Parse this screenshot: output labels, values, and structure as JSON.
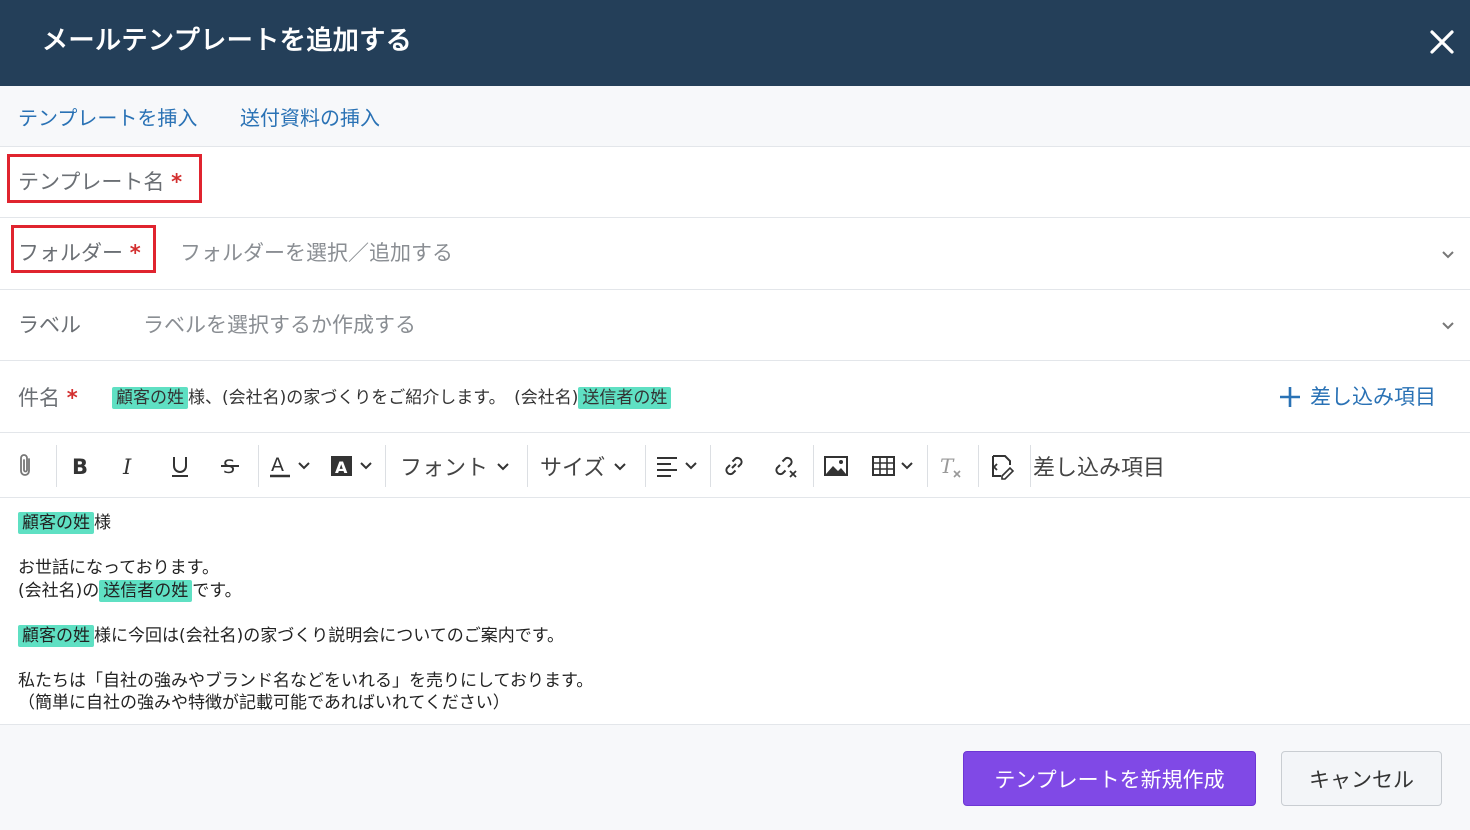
{
  "header": {
    "title": "メールテンプレートを追加する"
  },
  "topbar": {
    "insert_template": "テンプレートを挿入",
    "insert_attachment": "送付資料の挿入"
  },
  "fields": {
    "template_name": {
      "label": "テンプレート名",
      "required_mark": "*"
    },
    "folder": {
      "label": "フォルダー",
      "required_mark": "*",
      "placeholder": "フォルダーを選択／追加する"
    },
    "label": {
      "label": "ラベル",
      "placeholder": "ラベルを選択するか作成する"
    },
    "subject": {
      "label": "件名",
      "required_mark": "*",
      "chip1": "顧客の姓",
      "text1": "様、(会社名)の家づくりをご紹介します。　(会社名)",
      "chip2": "送信者の姓",
      "merge_label": "差し込み項目"
    }
  },
  "toolbar": {
    "font_label": "フォント",
    "size_label": "サイズ",
    "merge_label": "差し込み項目"
  },
  "editor": {
    "chip_customer": "顧客の姓",
    "chip_sender": "送信者の姓",
    "l1_after": "様",
    "l2": "お世話になっております。",
    "l3_before": "(会社名)の",
    "l3_after": "です。",
    "l4_after": "様に今回は(会社名)の家づくり説明会についてのご案内です。",
    "l5": "私たちは「自社の強みやブランド名などをいれる」を売りにしております。",
    "l6": "（簡単に自社の強みや特徴が記載可能であればいれてください）"
  },
  "footer": {
    "create_button": "テンプレートを新規作成",
    "cancel_button": "キャンセル"
  },
  "colors": {
    "header_bg": "#243f59",
    "accent_link": "#2a72b5",
    "primary_button": "#8049e6",
    "chip": "#5fe0c3",
    "required": "#d32f2f",
    "highlight_box": "#e0242f"
  }
}
